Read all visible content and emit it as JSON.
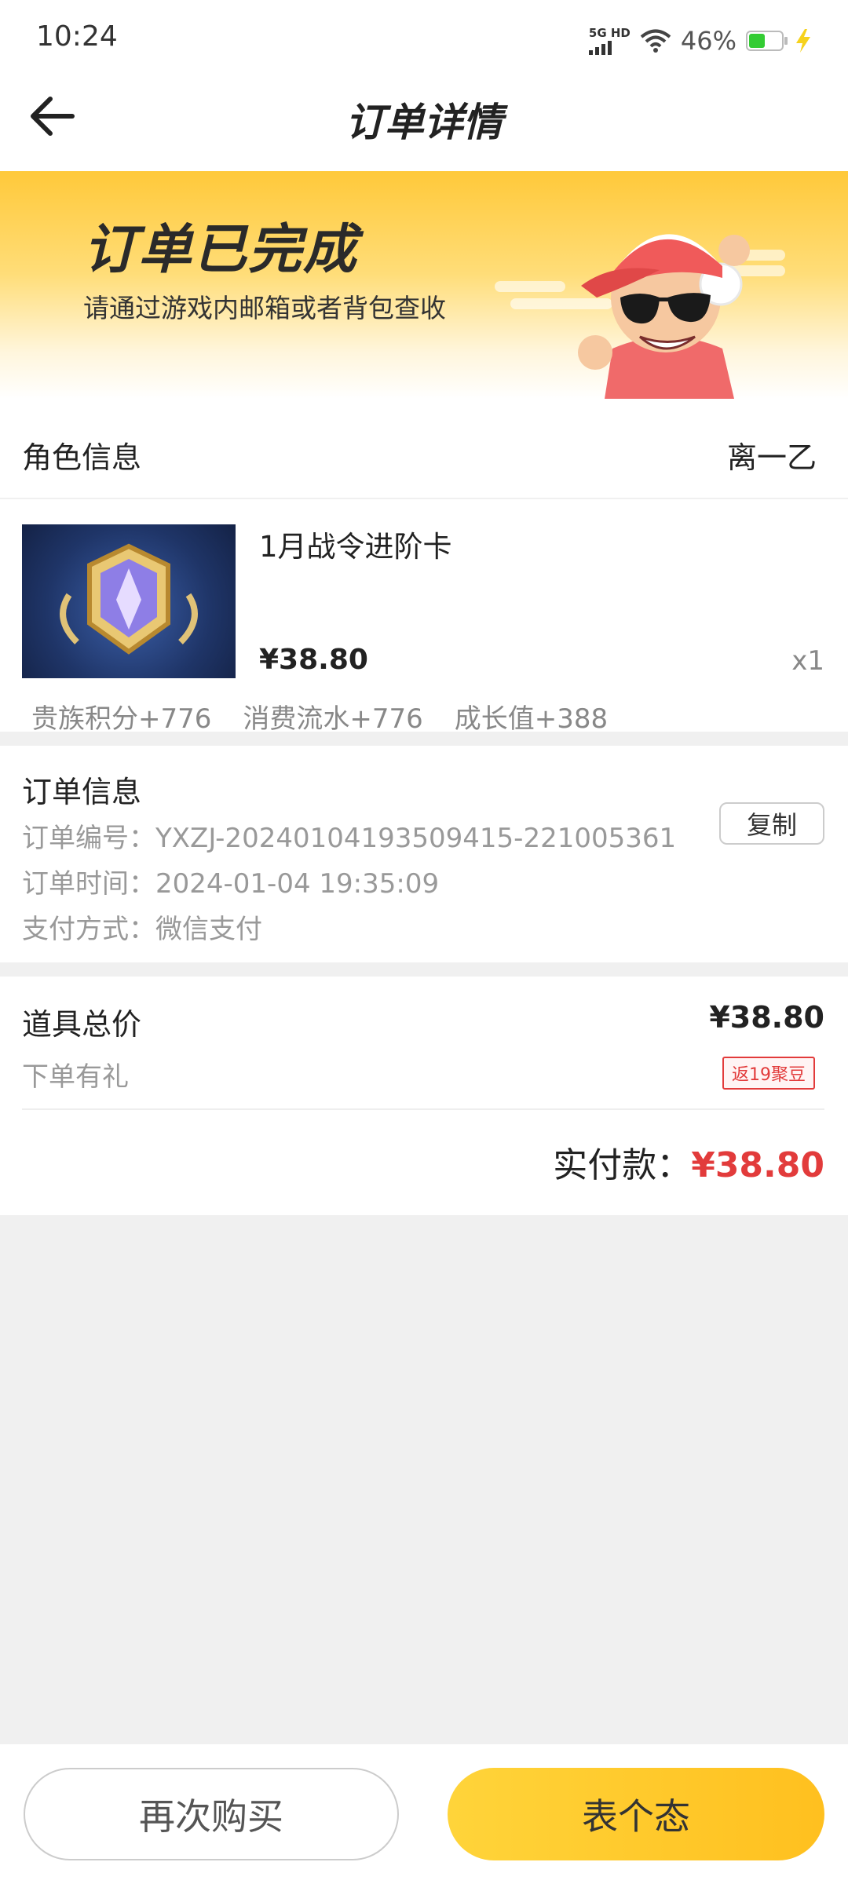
{
  "status_bar": {
    "time": "10:24",
    "network": "5G HD",
    "battery_percent": "46%",
    "battery_level": 0.46
  },
  "header": {
    "title": "订单详情"
  },
  "banner": {
    "title": "订单已完成",
    "subtitle": "请通过游戏内邮箱或者背包查收"
  },
  "role": {
    "label": "角色信息",
    "value": "离一乙"
  },
  "product": {
    "name": "1月战令进阶卡",
    "price": "¥38.80",
    "quantity": "x1",
    "perks": [
      "贵族积分+776",
      "消费流水+776",
      "成长值+388"
    ]
  },
  "order_info": {
    "title": "订单信息",
    "number_label": "订单编号：",
    "number_value": "YXZJ-20240104193509415-221005361",
    "time_label": "订单时间：",
    "time_value": "2024-01-04 19:35:09",
    "payment_label": "支付方式：",
    "payment_value": "微信支付",
    "copy_label": "复制"
  },
  "summary": {
    "total_label": "道具总价",
    "total_value": "¥38.80",
    "gift_label": "下单有礼",
    "gift_badge": "返19聚豆",
    "paid_label": "实付款：",
    "paid_value": "¥38.80"
  },
  "actions": {
    "rebuy_label": "再次购买",
    "review_label": "表个态"
  },
  "colors": {
    "accent_yellow": "#ffc93a",
    "price_red": "#e23b3b"
  }
}
